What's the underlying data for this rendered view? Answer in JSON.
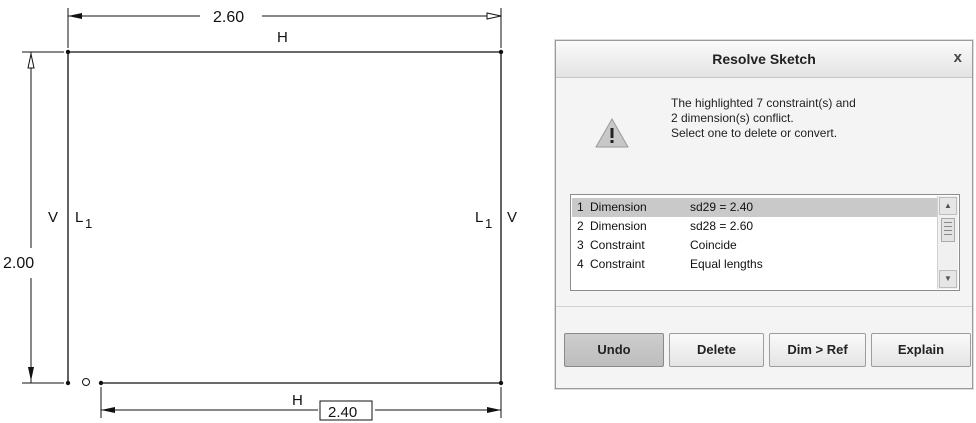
{
  "sketch": {
    "top_dimension": "2.60",
    "left_dimension": "2.00",
    "bottom_dimension": "2.40",
    "top_constraint": "H",
    "bottom_constraint": "H",
    "left_constraint": "V",
    "right_constraint": "V",
    "left_length_label": "L",
    "left_length_sub": "1",
    "right_length_label": "L",
    "right_length_sub": "1"
  },
  "dialog": {
    "title": "Resolve Sketch",
    "close_label": "x",
    "message_lines": [
      "The highlighted 7 constraint(s) and",
      "2 dimension(s) conflict.",
      "Select one to delete or convert."
    ],
    "warning_icon": "warning-triangle-icon",
    "conflicts": [
      {
        "num": "1",
        "type": "Dimension",
        "value": "sd29  =  2.40",
        "selected": true
      },
      {
        "num": "2",
        "type": "Dimension",
        "value": "sd28  =  2.60",
        "selected": false
      },
      {
        "num": "3",
        "type": "Constraint",
        "value": "Coincide",
        "selected": false
      },
      {
        "num": "4",
        "type": "Constraint",
        "value": "Equal lengths",
        "selected": false
      }
    ],
    "buttons": {
      "undo": "Undo",
      "delete": "Delete",
      "dim_ref": "Dim > Ref",
      "explain": "Explain"
    }
  }
}
